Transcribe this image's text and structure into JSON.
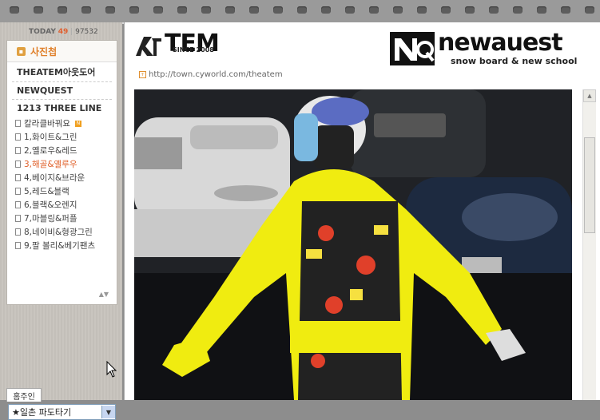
{
  "counter": {
    "today_label": "TODAY",
    "today": "49",
    "total": "97532"
  },
  "menu": {
    "title": "사진첩",
    "sections": [
      "THEATEM아웃도어",
      "NEWQUEST",
      "1213 THREE LINE"
    ],
    "items": [
      {
        "label": "칼라클바꿔요",
        "new": true
      },
      {
        "label": "1,화이트&그린"
      },
      {
        "label": "2,옐로우&레드"
      },
      {
        "label": "3,해골&옐루우",
        "active": true
      },
      {
        "label": "4,베이지&브라운"
      },
      {
        "label": "5,레드&블랙"
      },
      {
        "label": "6,블랙&오렌지"
      },
      {
        "label": "7,마블링&퍼플"
      },
      {
        "label": "8,네이비&형광그린"
      },
      {
        "label": "9,팔 볼리&베기팬츠"
      }
    ]
  },
  "home": {
    "tab": "홈주인",
    "select_value": "★일촌 파도타기"
  },
  "header": {
    "logo_left": "TEM",
    "logo_since": "SINCE 2008",
    "url": "http://town.cyworld.com/theatem",
    "logo_right": "newauest",
    "logo_right_sub": "snow board & new school"
  },
  "colors": {
    "accent": "#e0802a",
    "jacket": "#f2f000"
  }
}
